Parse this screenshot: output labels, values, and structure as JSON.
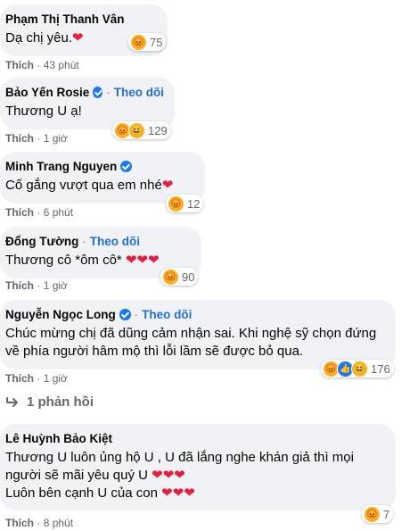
{
  "comments": [
    {
      "name": "Phạm Thị Thanh Vân",
      "text": "Dạ chị yêu.",
      "reaction_count": "75",
      "like_label": "Thích",
      "time": "43 phút"
    },
    {
      "name": "Bảo Yến Rosie",
      "follow_label": "Theo dõi",
      "text": "Thương U ạ!",
      "reaction_count": "129",
      "like_label": "Thích",
      "time": "1 giờ"
    },
    {
      "name": "Minh Trang Nguyen",
      "text": "Cố gắng vượt qua em nhé",
      "reaction_count": "12",
      "like_label": "Thích",
      "time": "6 phút"
    },
    {
      "name": "Đổng Tường",
      "follow_label": "Theo dõi",
      "text": "Thương cô *ôm cô*",
      "reaction_count": "90",
      "like_label": "Thích",
      "time": "1 giờ"
    },
    {
      "name": "Nguyễn Ngọc Long",
      "follow_label": "Theo dõi",
      "text": "Chúc mừng chị đã dũng cảm nhận sai. Khi nghệ sỹ chọn đứng về phía người hâm mộ thì lỗi lầm sẽ được bỏ qua.",
      "reaction_count": "176",
      "like_label": "Thích",
      "time": "1 giờ"
    },
    {
      "name": "Lê Huỳnh Bảo Kiệt",
      "text_line1": "Thương U luôn ủng hộ U , U đã lắng nghe khán giả thì mọi người sẽ mãi yêu quý U",
      "text_line2": "Luôn bên cạnh U của con",
      "reaction_count": "7",
      "like_label": "Thích",
      "time": "8 phút"
    }
  ],
  "replies_label": "1 phản hồi",
  "separator": "·",
  "heart_glyph": "❤",
  "colors": {
    "bubble": "#f0f2f5",
    "link": "#216fdb",
    "verified": "#1877f2",
    "muted": "#65676b",
    "heart": "#e41e3f"
  }
}
